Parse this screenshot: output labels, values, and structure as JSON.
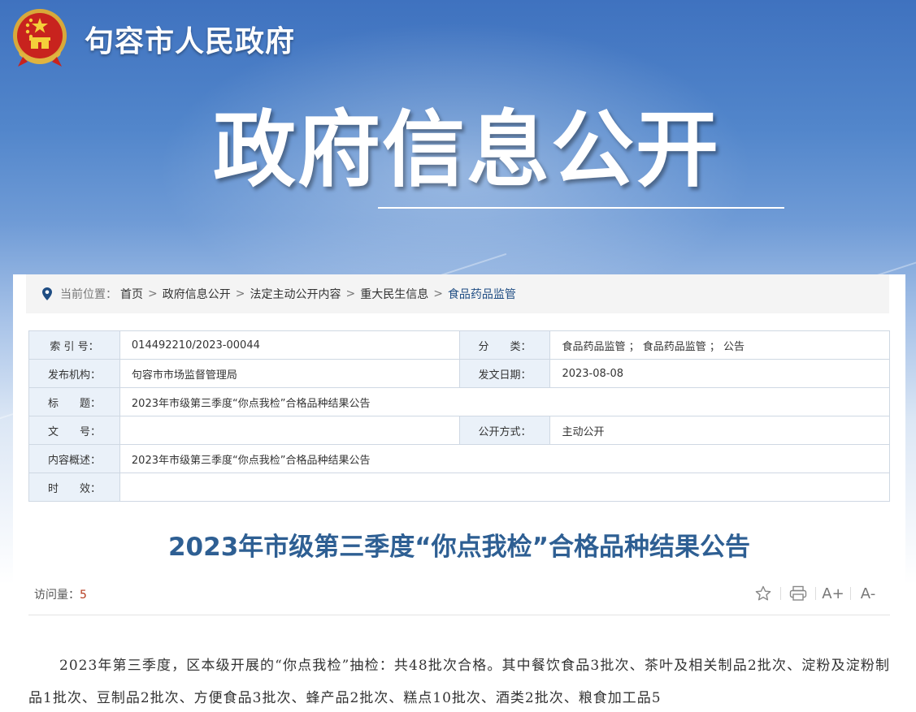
{
  "site": {
    "name": "句容市人民政府"
  },
  "banner": {
    "section_title": "政府信息公开"
  },
  "breadcrumb": {
    "label": "当前位置：",
    "items": [
      "首页",
      "政府信息公开",
      "法定主动公开内容",
      "重大民生信息",
      "食品药品监管"
    ],
    "separator": ">"
  },
  "meta": {
    "index_label": "索 引 号：",
    "index_value": "014492210/2023-00044",
    "category_label": "分　　类：",
    "category_value": "食品药品监管 ； 食品药品监管 ； 公告",
    "publisher_label": "发布机构：",
    "publisher_value": "句容市市场监督管理局",
    "date_label": "发文日期：",
    "date_value": "2023-08-08",
    "title_label": "标　　题：",
    "title_value": "2023年市级第三季度“你点我检”合格品种结果公告",
    "docno_label": "文　　号：",
    "docno_value": "",
    "open_label": "公开方式：",
    "open_value": "主动公开",
    "summary_label": "内容概述：",
    "summary_value": "2023年市级第三季度“你点我检”合格品种结果公告",
    "validity_label": "时　　效：",
    "validity_value": ""
  },
  "article": {
    "title": "2023年市级第三季度“你点我检”合格品种结果公告",
    "visits_label": "访问量：",
    "visits": "5",
    "body": "2023年第三季度，区本级开展的“你点我检”抽检：共48批次合格。其中餐饮食品3批次、茶叶及相关制品2批次、淀粉及淀粉制品1批次、豆制品2批次、方便食品3批次、蜂产品2批次、糕点10批次、酒类2批次、粮食加工品5"
  },
  "toolbar": {
    "favorite_icon": "star-icon",
    "print_icon": "printer-icon",
    "font_increase": "A+",
    "font_decrease": "A-"
  },
  "colors": {
    "banner_top": "#3f72bf",
    "accent_title": "#2e5f93",
    "table_key_bg": "#eaf1f9",
    "visits_number": "#b53a1e"
  }
}
